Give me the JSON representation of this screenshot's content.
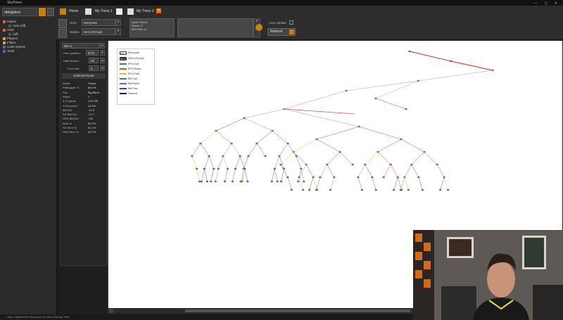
{
  "app": {
    "title": "SkyPoker",
    "window_controls": "— ▢ ✕"
  },
  "sidebar": {
    "select_value": "dbbigblind",
    "items": [
      {
        "label": "Import",
        "color": "#e2661d"
      },
      {
        "label": "Auto (off)",
        "color": "#555555"
      },
      {
        "label": "HUD",
        "color": "#e2661d"
      },
      {
        "label": "(off)",
        "color": "#555555"
      },
      {
        "label": "Players",
        "color": "#e2a21d"
      },
      {
        "label": "Filters",
        "color": "#e2a21d"
      },
      {
        "label": "Cash Games",
        "color": "#3a6bd0"
      },
      {
        "label": "Tools",
        "color": "#3a6bd0"
      }
    ]
  },
  "tabs": [
    {
      "label": "Home"
    },
    {
      "label": "My Trees 1"
    },
    {
      "label": "My Trees 2"
    }
  ],
  "toolbar": {
    "hero_label": "Hero",
    "hero_value": "Everyone",
    "stakes_label": "Stakes",
    "stakes_value": "Hero (Group)",
    "spots_text": [
      "Spots Select",
      "Street: 0",
      "Bet Path: %"
    ],
    "auto_update_label": "Auto Update",
    "refresh_label": "Refresh"
  },
  "left_panel": {
    "top_select": "NE-H",
    "hero_position_label": "Hero position:",
    "hero_position_value": "BTN",
    "hide_nodes_label": "Hide Nodes <",
    "hide_nodes_value": "20",
    "font_size_label": "Font Size",
    "font_size_value": "8",
    "selected_node_header": "Selected Node",
    "stats": [
      {
        "k": "Action",
        "v": "Check"
      },
      {
        "k": "Preflopper %",
        "v": "88.0%"
      },
      {
        "k": "Pos",
        "v": "Big Blind"
      },
      {
        "k": "Street",
        "v": "1"
      },
      {
        "k": "# of hands",
        "v": "124,739"
      },
      {
        "k": "% Reached",
        "v": "40.2%"
      },
      {
        "k": "BB/100",
        "v": "-11.5"
      },
      {
        "k": "SD BB/100",
        "v": "-17.7"
      },
      {
        "k": "NSD BB/100",
        "v": "-3.6"
      },
      {
        "k": "Won %",
        "v": "50.2%"
      },
      {
        "k": "SD Won %",
        "v": "41.1%"
      },
      {
        "k": "NSD Won %",
        "v": "63.7%"
      }
    ]
  },
  "legend": {
    "items": [
      {
        "kind": "box",
        "box": "BTN %",
        "label": "Everyone"
      },
      {
        "kind": "box",
        "box": "BB %",
        "label": "Hero (Group)"
      },
      {
        "kind": "line",
        "color": "#2f8a3b",
        "label": "BTN Call"
      },
      {
        "kind": "line",
        "color": "#e05030",
        "label": "BTN Raise"
      },
      {
        "kind": "line",
        "color": "#d7c12a",
        "label": "BTN Fold"
      },
      {
        "kind": "line",
        "color": "#2a7fd4",
        "label": "BB Call"
      },
      {
        "kind": "line",
        "color": "#8a4fd0",
        "label": "BB Raise"
      },
      {
        "kind": "line",
        "color": "#2a3fd4",
        "label": "BB Fold"
      },
      {
        "kind": "line",
        "color": "#222222",
        "label": "Discard"
      }
    ]
  },
  "status": {
    "text": "Hero: selected for Everyone vs Hero (Group) Tree"
  }
}
